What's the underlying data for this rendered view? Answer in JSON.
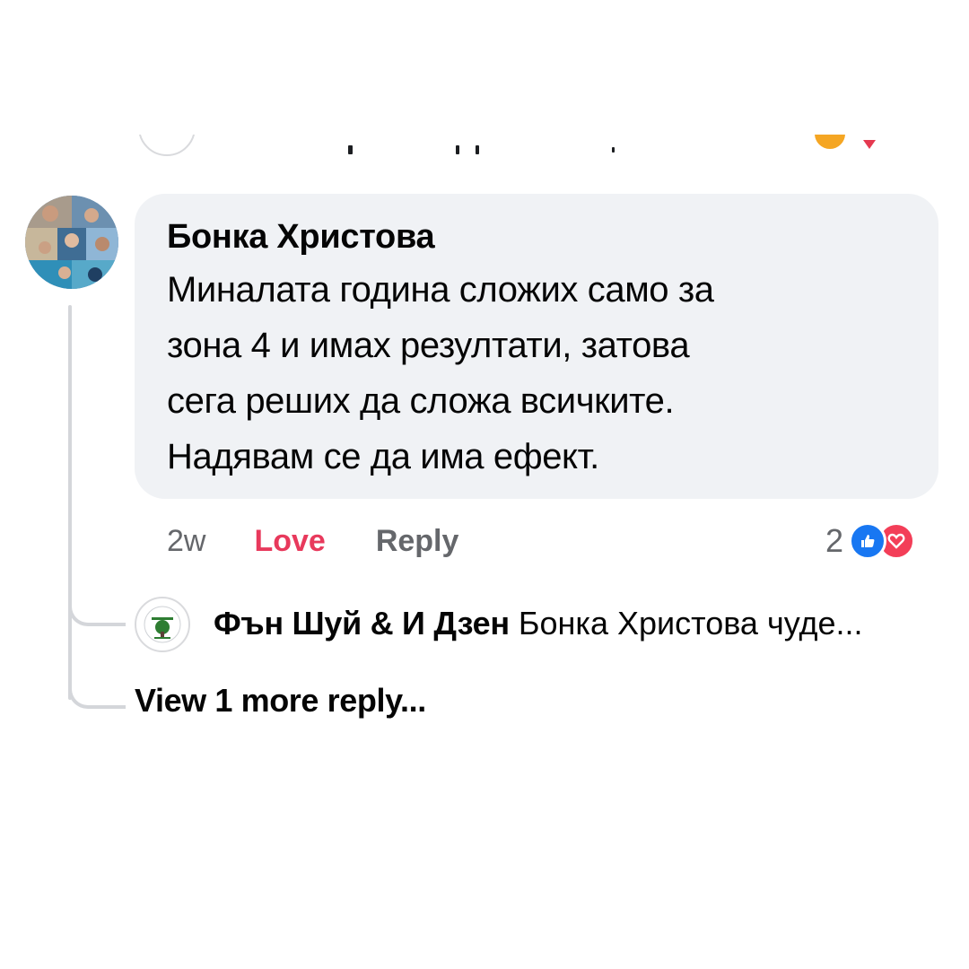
{
  "comment": {
    "author": "Бонка Христова",
    "text": "Миналата година сложих само за\nзона 4 и имах резултати, затова\nсега реших да сложа всичките.\nНадявам се да има ефект.",
    "time": "2w",
    "love_label": "Love",
    "reply_label": "Reply",
    "reaction_count": "2",
    "reactions": [
      "like-icon",
      "love-icon"
    ]
  },
  "reply": {
    "author": "Фън Шуй & И Дзен",
    "preview": "Бонка Христова чуде..."
  },
  "view_more_label": "View 1 more reply...",
  "colors": {
    "love": "#e8395c",
    "like_blue": "#1877f2",
    "heart_red": "#f33e58",
    "bubble_bg": "#f0f2f5",
    "muted_text": "#65676b"
  }
}
